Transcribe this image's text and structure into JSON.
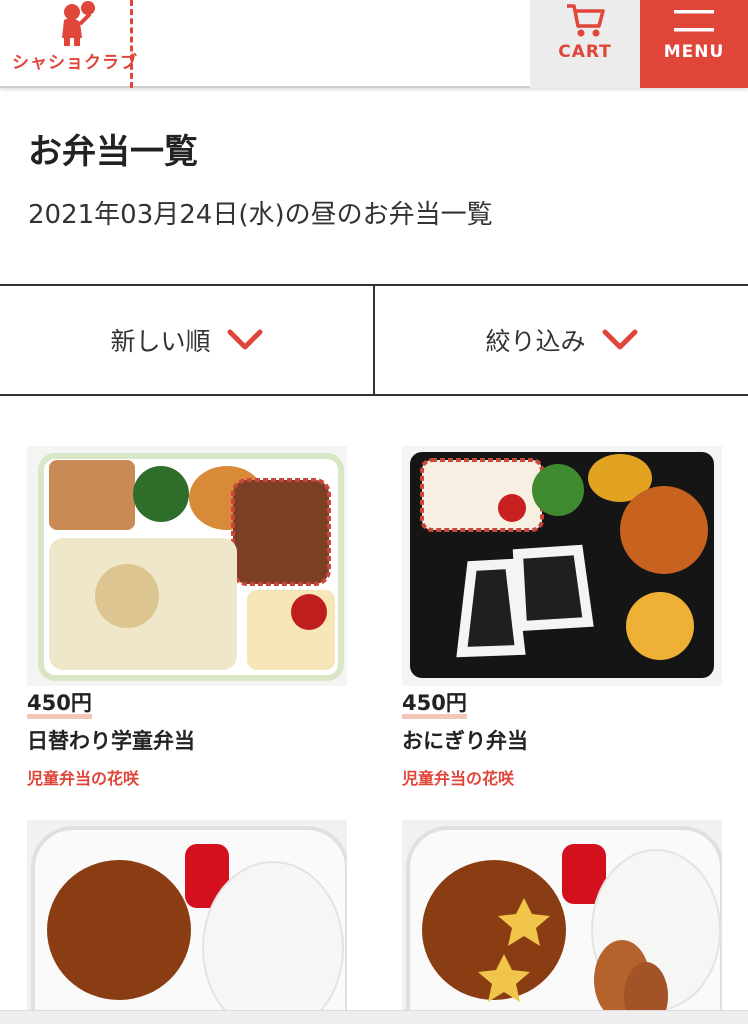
{
  "header": {
    "logo_text": "シャショクラブ",
    "cart_label": "CART",
    "menu_label": "MENU"
  },
  "page": {
    "title": "お弁当一覧",
    "subtitle": "2021年03月24日(水)の昼のお弁当一覧"
  },
  "filters": {
    "sort_label": "新しい順",
    "filter_label": "絞り込み"
  },
  "items": [
    {
      "price": "450円",
      "name": "日替わり学童弁当",
      "shop": "児童弁当の花咲"
    },
    {
      "price": "450円",
      "name": "おにぎり弁当",
      "shop": "児童弁当の花咲"
    }
  ],
  "colors": {
    "accent": "#e0453a",
    "price_underline": "#f3c6b8"
  }
}
